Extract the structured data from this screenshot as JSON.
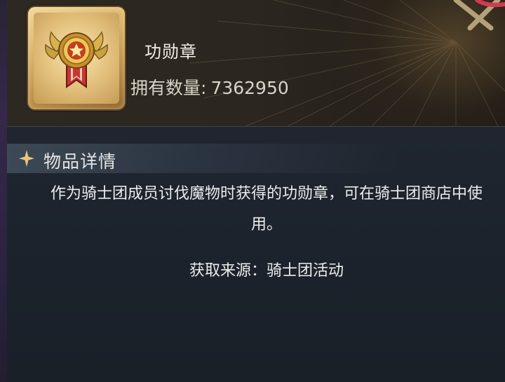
{
  "item": {
    "name": "功勋章",
    "count_label": "拥有数量:",
    "count_value": "7362950",
    "icon": "medal-icon"
  },
  "details": {
    "section_title": "物品详情",
    "section_icon": "sparkle-star-icon",
    "description": "作为骑士团成员讨伐魔物时获得的功勋章，可在骑士团商店中使用。",
    "source": "获取来源：骑士团活动"
  },
  "colors": {
    "header_bg": "#2b261f",
    "panel_bg": "#1b222b",
    "text_primary": "#f3efe6",
    "gold_accent": "#d9b46a",
    "medal_red": "#c8372f"
  }
}
